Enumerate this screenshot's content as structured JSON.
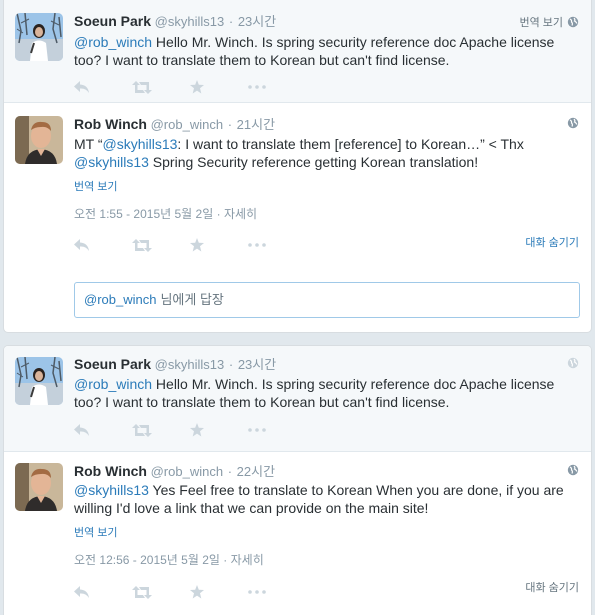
{
  "conversation1": {
    "tweet1": {
      "fullname": "Soeun Park",
      "username": "@skyhills13",
      "dot": "·",
      "time": "23시간",
      "translate": "번역 보기",
      "mention": "@rob_winch",
      "text": " Hello Mr. Winch. Is spring security reference doc Apache license too? I want to translate them to Korean but can't find license."
    },
    "tweet2": {
      "fullname": "Rob Winch",
      "username": "@rob_winch",
      "dot": "·",
      "time": "21시간",
      "text_part1": "MT “",
      "mention1": "@skyhills13",
      "text_part2": ":  I want to translate them [reference] to Korean…” < Thx ",
      "mention2": "@skyhills13",
      "text_part3": "  Spring Security reference getting Korean translation!",
      "translate": "번역 보기",
      "timestamp": "오전 1:55 - 2015년 5월 2일",
      "details": "자세히",
      "collapse": "대화 숨기기"
    },
    "reply": {
      "mention": "@rob_winch",
      "placeholder": "님에게 답장"
    }
  },
  "conversation2": {
    "tweet1": {
      "fullname": "Soeun Park",
      "username": "@skyhills13",
      "dot": "·",
      "time": "23시간",
      "mention": "@rob_winch",
      "text": " Hello Mr. Winch. Is spring security reference doc Apache license too? I want to translate them to Korean but can't find license."
    },
    "tweet2": {
      "fullname": "Rob Winch",
      "username": "@rob_winch",
      "dot": "·",
      "time": "22시간",
      "mention": "@skyhills13",
      "text": " Yes Feel free to translate to Korean When you are done, if you are willing I'd love a link that we can provide on the main site!",
      "translate": "번역 보기",
      "timestamp": "오전 12:56 - 2015년 5월 2일",
      "details": "자세히",
      "collapse": "대화 숨기기"
    }
  },
  "icons": {
    "reply": "reply-icon",
    "retweet": "retweet-icon",
    "favorite": "favorite-icon",
    "more": "more-icon",
    "globe": "globe-icon"
  },
  "colors": {
    "link": "#2b7bb9",
    "muted": "#8899a6",
    "icon": "#ccd6dd",
    "background": "#e1e8ed"
  }
}
